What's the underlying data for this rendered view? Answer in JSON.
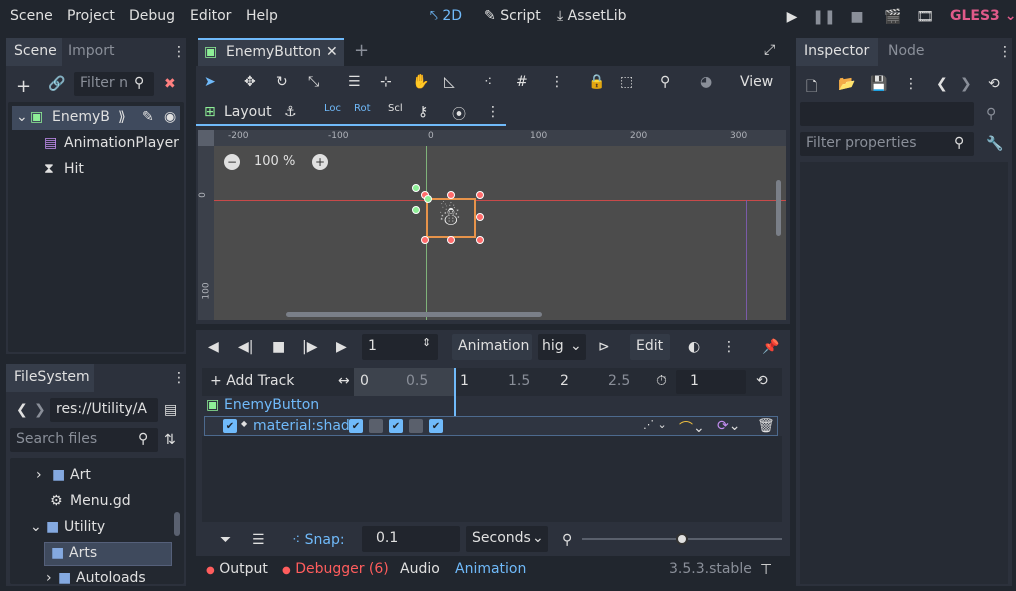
{
  "menu": {
    "scene": "Scene",
    "project": "Project",
    "debug": "Debug",
    "editor": "Editor",
    "help": "Help"
  },
  "workspaces": {
    "twod": "2D",
    "script": "Script",
    "assetlib": "AssetLib"
  },
  "renderer": "GLES3",
  "scene_dock": {
    "tab_scene": "Scene",
    "tab_import": "Import",
    "filter_placeholder": "Filter n",
    "nodes": [
      {
        "label": "EnemyB"
      },
      {
        "label": "AnimationPlayer"
      },
      {
        "label": "Hit"
      }
    ]
  },
  "filesystem": {
    "tab": "FileSystem",
    "path": "res://Utility/A",
    "search_placeholder": "Search files",
    "items": [
      {
        "label": "Art"
      },
      {
        "label": "Menu.gd"
      },
      {
        "label": "Utility"
      },
      {
        "label": "Arts"
      },
      {
        "label": "Autoloads"
      }
    ]
  },
  "editor_tab": {
    "name": "EnemyButton"
  },
  "viewport": {
    "view_label": "View",
    "layout_label": "Layout",
    "zoom": "100 %",
    "ruler_h": [
      "-200",
      "-100",
      "0",
      "100",
      "200",
      "300"
    ],
    "ruler_v": [
      "0",
      "100"
    ],
    "icons": {
      "loc": "Loc",
      "rot": "Rot",
      "scl": "Scl",
      "key": "Key"
    }
  },
  "animation": {
    "time_value": "1",
    "animation_label": "Animation",
    "anim_name": "hig",
    "edit_label": "Edit",
    "add_track": "Add Track",
    "timeline_ticks": [
      "0",
      "0.5",
      "1",
      "1.5",
      "2",
      "2.5"
    ],
    "length": "1",
    "tracks": {
      "node": "EnemyButton",
      "property": "material:shad"
    },
    "snap_label": "Snap:",
    "snap_value": "0.1",
    "snap_unit": "Seconds"
  },
  "bottom_bar": {
    "output": "Output",
    "debugger": "Debugger (6)",
    "audio": "Audio",
    "animation": "Animation",
    "version": "3.5.3.stable"
  },
  "inspector": {
    "tab_inspector": "Inspector",
    "tab_node": "Node",
    "filter_placeholder": "Filter properties"
  },
  "colors": {
    "accent": "#70bafa",
    "selection": "#3f4a5d",
    "renderer": "#e05a8a",
    "error": "#ff5d5d"
  }
}
